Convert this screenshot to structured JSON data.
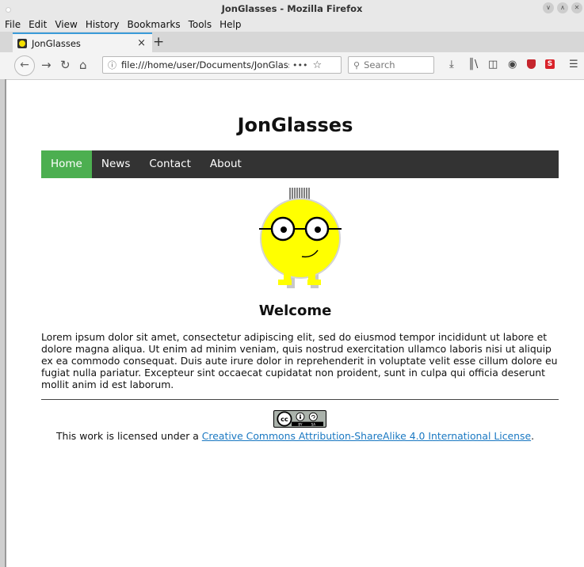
{
  "window": {
    "title": "JonGlasses - Mozilla Firefox"
  },
  "menubar": {
    "items": [
      "File",
      "Edit",
      "View",
      "History",
      "Bookmarks",
      "Tools",
      "Help"
    ]
  },
  "tabs": [
    {
      "label": "JonGlasses",
      "close": "×"
    }
  ],
  "newtab": "+",
  "navbar": {
    "url": "file:///home/user/Documents/JonGlasses/jon",
    "url_menu": "•••",
    "search_placeholder": "Search"
  },
  "site": {
    "title": "JonGlasses",
    "nav": [
      "Home",
      "News",
      "Contact",
      "About"
    ],
    "active_nav": "Home",
    "welcome": "Welcome",
    "body": "Lorem ipsum dolor sit amet, consectetur adipiscing elit, sed do eiusmod tempor incididunt ut labore et dolore magna aliqua. Ut enim ad minim veniam, quis nostrud exercitation ullamco laboris nisi ut aliquip ex ea commodo consequat. Duis aute irure dolor in reprehenderit in voluptate velit esse cillum dolore eu fugiat nulla pariatur. Excepteur sint occaecat cupidatat non proident, sunt in culpa qui officia deserunt mollit anim id est laborum.",
    "license_prefix": "This work is licensed under a ",
    "license_link": "Creative Commons Attribution-ShareAlike 4.0 International License",
    "license_suffix": ".",
    "badge_text": [
      "cc",
      "BY",
      "SA"
    ]
  },
  "colors": {
    "nav_bg": "#333333",
    "nav_active": "#4caf50",
    "link": "#1a78c2",
    "mascot": "#ffff00"
  }
}
